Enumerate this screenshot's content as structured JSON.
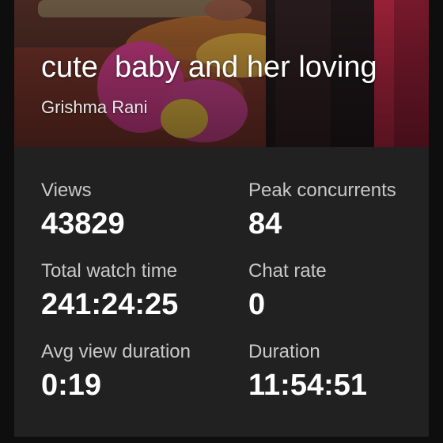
{
  "video": {
    "title": "cute  baby and her loving",
    "author": "Grishma Rani"
  },
  "stats": {
    "views": {
      "label": "Views",
      "value": "43829"
    },
    "peak_concurrents": {
      "label": "Peak concurrents",
      "value": "84"
    },
    "total_watch_time": {
      "label": "Total watch time",
      "value": "241:24:25"
    },
    "chat_rate": {
      "label": "Chat rate",
      "value": "0"
    },
    "avg_view_duration": {
      "label": "Avg view duration",
      "value": "0:19"
    },
    "duration": {
      "label": "Duration",
      "value": "11:54:51"
    }
  },
  "colors": {
    "background": "#0e0e0e",
    "card": "#212121",
    "label_text": "#c9c9c9",
    "value_text": "#ffffff"
  }
}
